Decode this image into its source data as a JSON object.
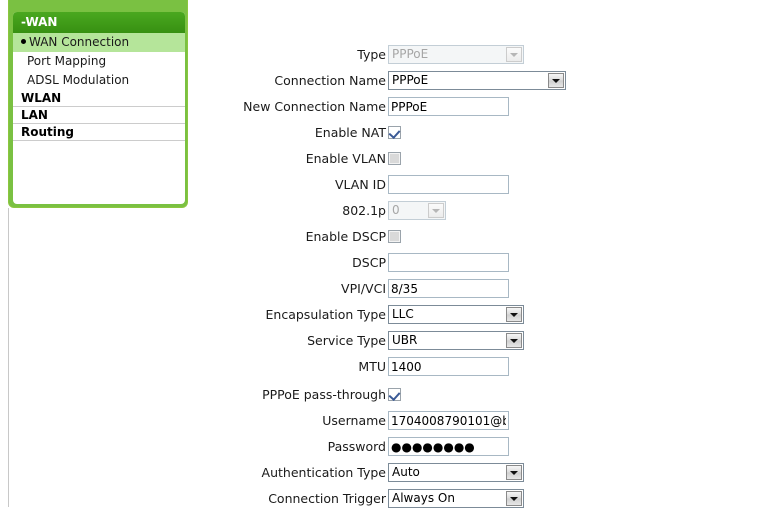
{
  "sidebar": {
    "group": {
      "label": "-WAN",
      "items": [
        {
          "label": "WAN Connection",
          "selected": true
        },
        {
          "label": "Port Mapping",
          "selected": false
        },
        {
          "label": "ADSL Modulation",
          "selected": false
        }
      ]
    },
    "sections": [
      {
        "label": "WLAN"
      },
      {
        "label": "LAN"
      },
      {
        "label": "Routing"
      }
    ]
  },
  "form": {
    "rows": [
      {
        "label": "Type",
        "value": "PPPoE"
      },
      {
        "label": "Connection Name",
        "value": "PPPoE"
      },
      {
        "label": "New Connection Name",
        "value": "PPPoE"
      },
      {
        "label": "Enable NAT",
        "value": ""
      },
      {
        "label": "Enable VLAN",
        "value": ""
      },
      {
        "label": "VLAN ID",
        "value": ""
      },
      {
        "label": "802.1p",
        "value": "0"
      },
      {
        "label": "Enable DSCP",
        "value": ""
      },
      {
        "label": "DSCP",
        "value": ""
      },
      {
        "label": "VPI/VCI",
        "value": "8/35"
      },
      {
        "label": "Encapsulation Type",
        "value": "LLC"
      },
      {
        "label": "Service Type",
        "value": "UBR"
      },
      {
        "label": "MTU",
        "value": "1400"
      },
      {
        "label": "PPPoE pass-through",
        "value": ""
      },
      {
        "label": "Username",
        "value": "1704008790101@b"
      },
      {
        "label": "Password",
        "value": "●●●●●●●●"
      },
      {
        "label": "Authentication Type",
        "value": "Auto"
      },
      {
        "label": "Connection Trigger",
        "value": "Always On"
      }
    ]
  },
  "colors": {
    "panel_green": "#7ac142",
    "header_green": "#3f9c1b",
    "selected_green": "#b5e59a",
    "field_border": "#a8b8c4"
  }
}
